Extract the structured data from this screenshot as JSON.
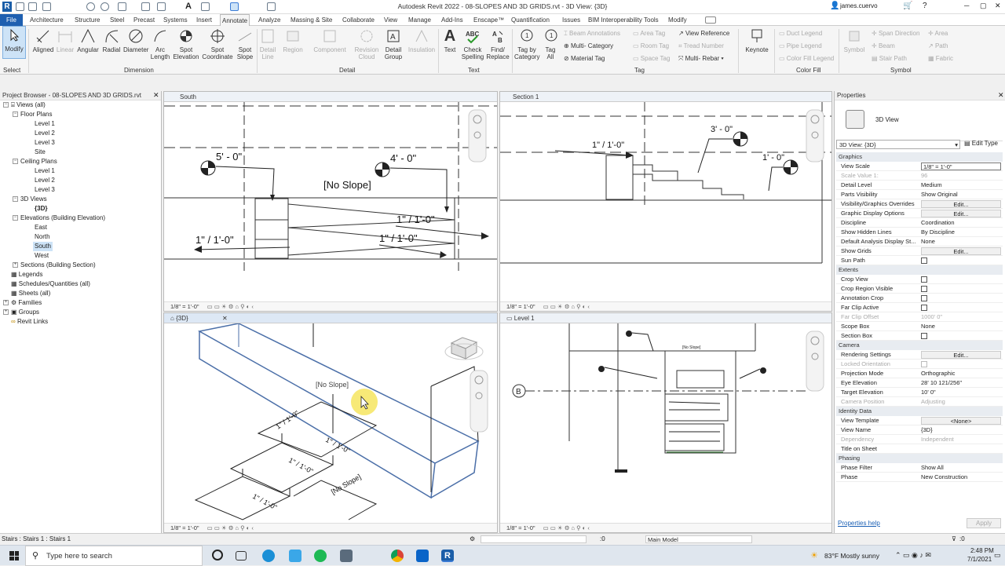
{
  "titlebar": {
    "title": "Autodesk Revit 2022 - 08-SLOPES AND 3D GRIDS.rvt - 3D View: {3D}",
    "user": "james.cuervo",
    "minimize": "─",
    "maximize": "▢",
    "close": "✕"
  },
  "menu": {
    "file": "File",
    "tabs": [
      "Architecture",
      "Structure",
      "Steel",
      "Precast",
      "Systems",
      "Insert",
      "Annotate",
      "Analyze",
      "Massing & Site",
      "Collaborate",
      "View",
      "Manage",
      "Add-Ins",
      "Enscape™",
      "Quantification",
      "Issues",
      "BIM Interoperability Tools",
      "Modify"
    ]
  },
  "ribbon": {
    "select": {
      "modify": "Modify",
      "label": "Select"
    },
    "dimension": {
      "aligned": "Aligned",
      "linear": "Linear",
      "angular": "Angular",
      "radial": "Radial",
      "diameter": "Diameter",
      "arc": "Arc Length",
      "elev": "Spot Elevation",
      "coord": "Spot Coordinate",
      "slope": "Spot Slope",
      "label": "Dimension"
    },
    "detail": {
      "line": "Detail Line",
      "region": "Region",
      "component": "Component",
      "revcloud": "Revision Cloud",
      "group": "Detail Group",
      "insulation": "Insulation",
      "label": "Detail"
    },
    "text": {
      "text": "Text",
      "check": "Check Spelling",
      "find": "Find/ Replace",
      "label": "Text"
    },
    "tag": {
      "bycat": "Tag by Category",
      "all": "Tag All",
      "beam": "Beam Annotations",
      "multicat": "Multi- Category",
      "material": "Material Tag",
      "area": "Area Tag",
      "room": "Room Tag",
      "space": "Space Tag",
      "viewref": "View Reference",
      "tread": "Tread Number",
      "multirebar": "Multi- Rebar",
      "label": "Tag"
    },
    "keynote": "Keynote",
    "colorfill": {
      "duct": "Duct Legend",
      "pipe": "Pipe Legend",
      "color": "Color Fill Legend",
      "label": "Color Fill"
    },
    "symbol": {
      "symbol": "Symbol",
      "span": "Span Direction",
      "beam": "Beam",
      "stair": "Stair Path",
      "area": "Area",
      "path": "Path",
      "fabric": "Fabric",
      "label": "Symbol"
    }
  },
  "browser": {
    "title": "Project Browser - 08-SLOPES AND 3D GRIDS.rvt",
    "items": [
      "Views (all)",
      "Floor Plans",
      "Level 1",
      "Level 2",
      "Level 3",
      "Site",
      "Ceiling Plans",
      "Level 1",
      "Level 2",
      "Level 3",
      "3D Views",
      "{3D}",
      "Elevations (Building Elevation)",
      "East",
      "North",
      "South",
      "West",
      "Sections (Building Section)",
      "Legends",
      "Schedules/Quantities (all)",
      "Sheets (all)",
      "Families",
      "Groups",
      "Revit Links"
    ]
  },
  "views": {
    "south": {
      "tab": "South",
      "scale": "1/8\" = 1'-0\"",
      "dims": [
        "5' - 0\"",
        "4' - 0\"",
        "[No Slope]",
        "1\" / 1'-0\"",
        "1\" / 1'-0\"",
        "1\" / 1'-0\""
      ]
    },
    "section": {
      "tab": "Section 1",
      "scale": "1/8\" = 1'-0\"",
      "dims": [
        "3' - 0\"",
        "1\" / 1'-0\"",
        "1' - 0\""
      ]
    },
    "threed": {
      "tab": "{3D}",
      "scale": "1/8\" = 1'-0\"",
      "labels": [
        "[No Slope]",
        "1\" / 1'-0\"",
        "1\" / 1'-0\"",
        "1\" / 1'-0\"",
        "1\" / 1'-0\"",
        "[No Slope]"
      ]
    },
    "level1": {
      "tab": "Level 1",
      "scale": "1/8\" = 1'-0\"",
      "grid": "B",
      "labels": [
        "[No Slope]"
      ]
    }
  },
  "properties": {
    "title": "Properties",
    "type": "3D View",
    "instance": "3D View: {3D}",
    "edit_type": "Edit Type",
    "groups": {
      "graphics": "Graphics",
      "extents": "Extents",
      "camera": "Camera",
      "identity": "Identity Data",
      "phasing": "Phasing"
    },
    "graphics": [
      [
        "View Scale",
        "1/8\" = 1'-0\""
      ],
      [
        "Scale Value 1:",
        "96"
      ],
      [
        "Detail Level",
        "Medium"
      ],
      [
        "Parts Visibility",
        "Show Original"
      ],
      [
        "Visibility/Graphics Overrides",
        "Edit..."
      ],
      [
        "Graphic Display Options",
        "Edit..."
      ],
      [
        "Discipline",
        "Coordination"
      ],
      [
        "Show Hidden Lines",
        "By Discipline"
      ],
      [
        "Default Analysis Display St...",
        "None"
      ],
      [
        "Show Grids",
        "Edit..."
      ],
      [
        "Sun Path",
        ""
      ]
    ],
    "extents": [
      [
        "Crop View",
        ""
      ],
      [
        "Crop Region Visible",
        ""
      ],
      [
        "Annotation Crop",
        ""
      ],
      [
        "Far Clip Active",
        ""
      ],
      [
        "Far Clip Offset",
        "1000' 0\""
      ],
      [
        "Scope Box",
        "None"
      ],
      [
        "Section Box",
        ""
      ]
    ],
    "camera": [
      [
        "Rendering Settings",
        "Edit..."
      ],
      [
        "Locked Orientation",
        ""
      ],
      [
        "Projection Mode",
        "Orthographic"
      ],
      [
        "Eye Elevation",
        "28' 10 121/256\""
      ],
      [
        "Target Elevation",
        "10' 0\""
      ],
      [
        "Camera Position",
        "Adjusting"
      ]
    ],
    "identity": [
      [
        "View Template",
        "<None>"
      ],
      [
        "View Name",
        "{3D}"
      ],
      [
        "Dependency",
        "Independent"
      ],
      [
        "Title on Sheet",
        ""
      ]
    ],
    "phasing": [
      [
        "Phase Filter",
        "Show All"
      ],
      [
        "Phase",
        "New Construction"
      ]
    ],
    "help": "Properties help",
    "apply": "Apply"
  },
  "status": {
    "text": "Stairs : Stairs 1 : Stairs 1",
    "zero": ":0",
    "model": "Main Model"
  },
  "taskbar": {
    "search": "Type here to search",
    "weather": "83°F  Mostly sunny",
    "time": "2:48 PM",
    "date": "7/1/2021"
  }
}
